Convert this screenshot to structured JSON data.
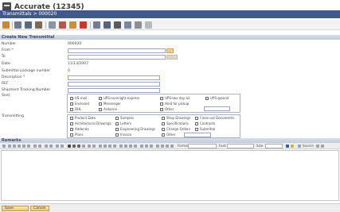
{
  "app": {
    "title": "Accurate (12345)"
  },
  "breadcrumb": "Transmittals > 000020",
  "form": {
    "section_title": "Create New Transmittal",
    "number_label": "Number",
    "number_value": "000020",
    "from_label": "From *",
    "to_label": "To",
    "date_label": "Date",
    "date_value": "11/13/2007",
    "submittal_label": "Submittal package number",
    "submittal_value": "0",
    "description_label": "Description *",
    "ref_label": "REF",
    "tracking_label": "Shipment Tracking Number",
    "sent_label": "Sent",
    "transmitting_label": "Transmitting",
    "lookup_glyph": "..."
  },
  "sent_options": [
    "US mail",
    "UPS-overnight express",
    "UPS-two day air",
    "UPS-ground",
    "Enclosed",
    "Messenger",
    "Hold for pickup",
    "DHL",
    "Airborne",
    "Other"
  ],
  "transmitting_options": [
    "Product Data",
    "Samples",
    "Shop Drawings",
    "Close-out Documents",
    "Architectural Drawings",
    "Letters",
    "Specifications",
    "Contracts",
    "Addenda",
    "Engineering Drawings",
    "Change Orders",
    "Submittal",
    "Plans",
    "Invoice",
    "Other"
  ],
  "remarks": {
    "section_title": "Remarks",
    "format_label": "Format",
    "font_label": "Font",
    "size_label": "Size",
    "source_label": "Source"
  },
  "buttons": {
    "save": "Save",
    "cancel": "Cancel"
  }
}
